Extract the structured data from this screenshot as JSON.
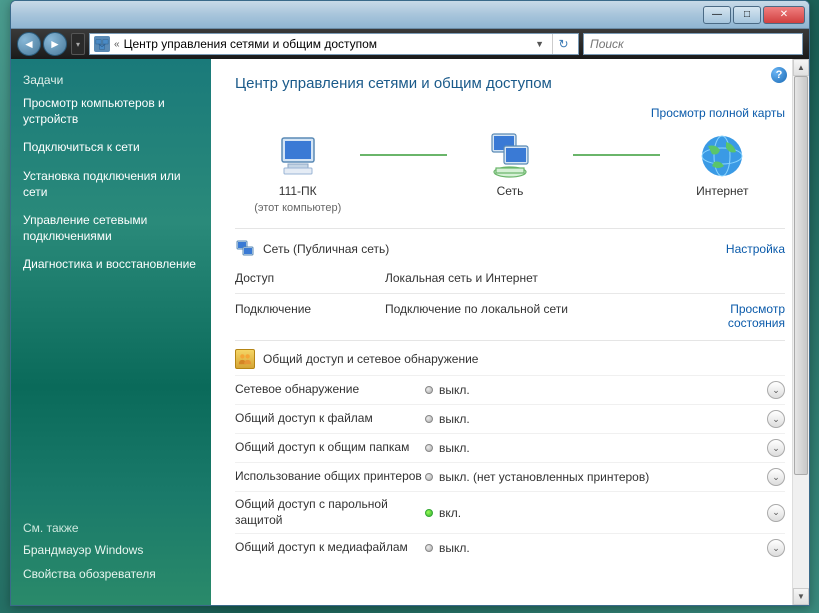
{
  "window": {
    "address_prefix": "«",
    "address": "Центр управления сетями и общим доступом",
    "search_placeholder": "Поиск"
  },
  "sidebar": {
    "tasks_heading": "Задачи",
    "links": [
      "Просмотр компьютеров и устройств",
      "Подключиться к сети",
      "Установка подключения или сети",
      "Управление сетевыми подключениями",
      "Диагностика и восстановление"
    ],
    "see_also_heading": "См. также",
    "footer_links": [
      "Брандмауэр Windows",
      "Свойства обозревателя"
    ]
  },
  "main": {
    "title": "Центр управления сетями и общим доступом",
    "full_map_link": "Просмотр полной карты",
    "map": {
      "pc_name": "111-ПК",
      "pc_sub": "(этот компьютер)",
      "network_name": "Сеть",
      "internet_name": "Интернет"
    },
    "network": {
      "title": "Сеть (Публичная сеть)",
      "customize": "Настройка",
      "rows": [
        {
          "label": "Доступ",
          "value": "Локальная сеть и Интернет",
          "action": ""
        },
        {
          "label": "Подключение",
          "value": "Подключение по локальной сети",
          "action": "Просмотр состояния"
        }
      ]
    },
    "sharing": {
      "title": "Общий доступ и сетевое обнаружение",
      "settings": [
        {
          "label": "Сетевое обнаружение",
          "status": "выкл.",
          "on": false
        },
        {
          "label": "Общий доступ к файлам",
          "status": "выкл.",
          "on": false
        },
        {
          "label": "Общий доступ к общим папкам",
          "status": "выкл.",
          "on": false
        },
        {
          "label": "Использование общих принтеров",
          "status": "выкл. (нет установленных принтеров)",
          "on": false
        },
        {
          "label": "Общий доступ с парольной защитой",
          "status": "вкл.",
          "on": true
        },
        {
          "label": "Общий доступ к медиафайлам",
          "status": "выкл.",
          "on": false
        }
      ]
    }
  }
}
